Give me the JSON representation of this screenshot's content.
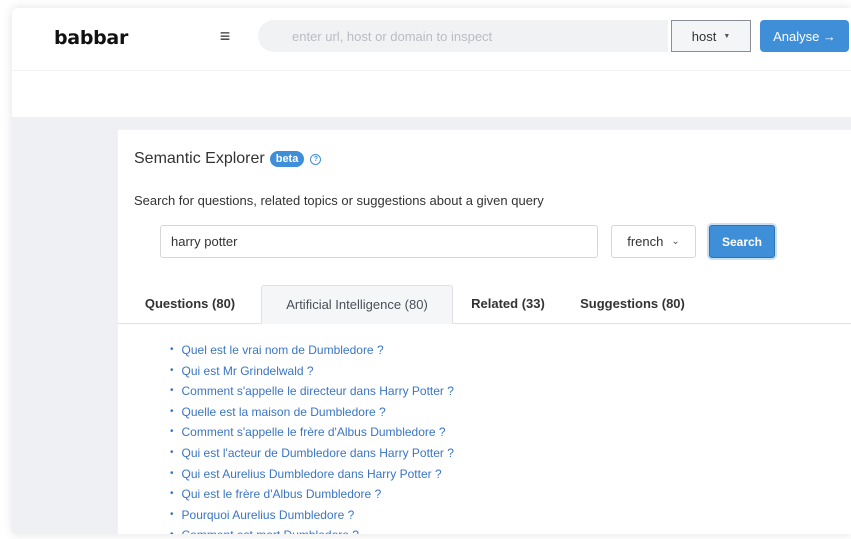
{
  "header": {
    "logo": "babbar",
    "url_placeholder": "enter url, host or domain to inspect",
    "scope_select": "host",
    "analyse_label": "Analyse →"
  },
  "explorer": {
    "title": "Semantic Explorer",
    "badge": "beta",
    "description": "Search for questions, related topics or suggestions about a given query",
    "query_value": "harry potter",
    "language": "french",
    "search_label": "Search"
  },
  "tabs": [
    {
      "label": "Questions (80)",
      "active": false
    },
    {
      "label": "Artificial Intelligence (80)",
      "active": true
    },
    {
      "label": "Related (33)",
      "active": false
    },
    {
      "label": "Suggestions (80)",
      "active": false
    }
  ],
  "results": [
    "Quel est le vrai nom de Dumbledore ?",
    "Qui est Mr Grindelwald ?",
    "Comment s'appelle le directeur dans Harry Potter ?",
    "Quelle est la maison de Dumbledore ?",
    "Comment s'appelle le frère d'Albus Dumbledore ?",
    "Qui est l'acteur de Dumbledore dans Harry Potter ?",
    "Qui est Aurelius Dumbledore dans Harry Potter ?",
    "Qui est le frère d'Albus Dumbledore ?",
    "Pourquoi Aurelius Dumbledore ?",
    "Comment est mort Dumbledore ?"
  ],
  "colors": {
    "accent": "#3f8ed8",
    "link": "#3a75c4"
  }
}
